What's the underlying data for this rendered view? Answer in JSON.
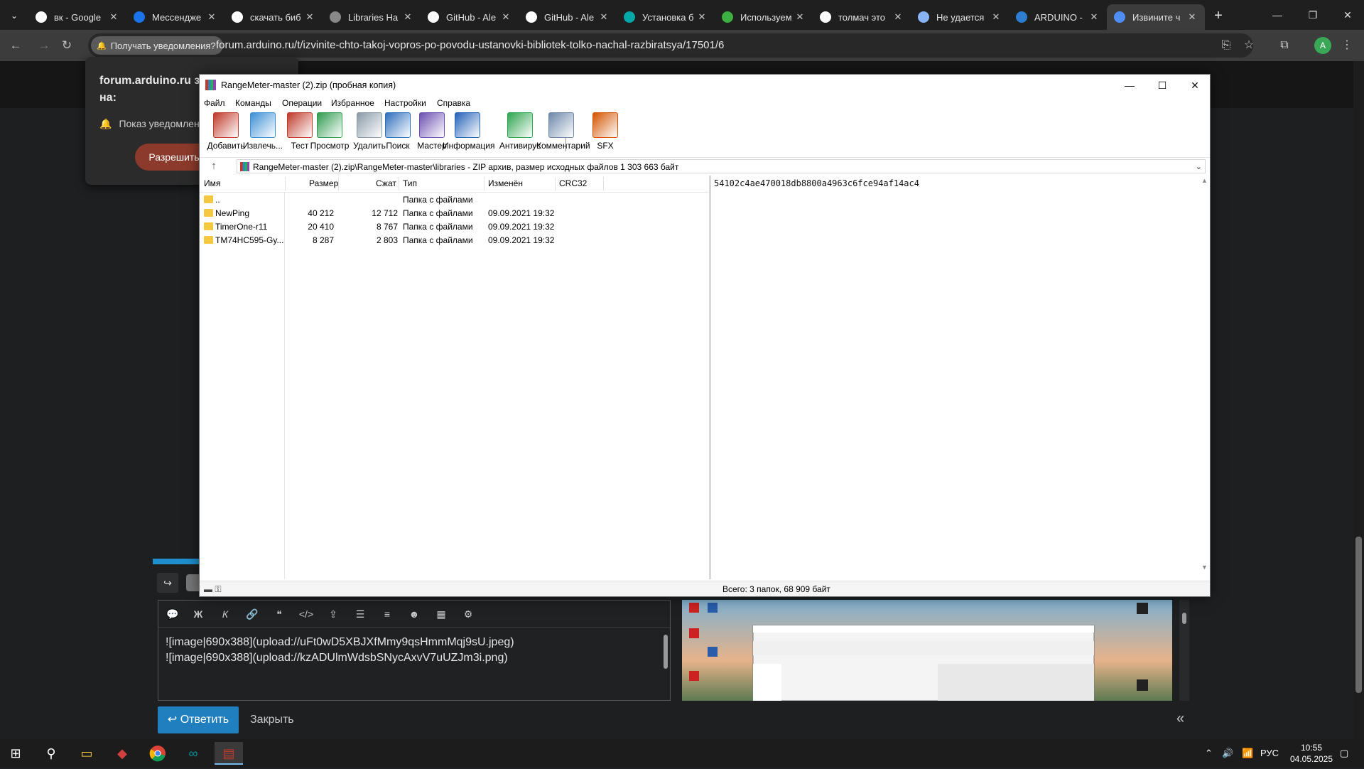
{
  "browser": {
    "tabs": [
      {
        "title": "вк - Google",
        "color": "#ffffff",
        "icon": "google-icon"
      },
      {
        "title": "Мессендже",
        "color": "#1a73e8",
        "icon": "messenger-icon"
      },
      {
        "title": "скачать биб",
        "color": "#ffffff",
        "icon": "google-icon"
      },
      {
        "title": "Libraries Ha",
        "color": "#888888",
        "icon": "globe-icon"
      },
      {
        "title": "GitHub - Ale",
        "color": "#ffffff",
        "icon": "github-icon"
      },
      {
        "title": "GitHub - Ale",
        "color": "#ffffff",
        "icon": "github-icon"
      },
      {
        "title": "Установка б",
        "color": "#00a8a8",
        "icon": "arduino-icon"
      },
      {
        "title": "Используем",
        "color": "#3cb043",
        "icon": "x-site-icon"
      },
      {
        "title": "толмач это",
        "color": "#ffffff",
        "icon": "google-icon"
      },
      {
        "title": "Не удается",
        "color": "#8ab4f8",
        "icon": "page-icon"
      },
      {
        "title": "ARDUINO -",
        "color": "#2e7dd1",
        "icon": "x-site-icon"
      },
      {
        "title": "Извините ч",
        "color": "#4f8ef7",
        "icon": "forum-icon"
      }
    ],
    "notif_chip": "Получать уведомления?",
    "url": "forum.arduino.ru/t/izvinite-chto-takoj-vopros-po-povodu-ustanovki-bibliotek-tolko-nachal-razbiratsya/17501/6",
    "avatar_letter": "A"
  },
  "permission_popup": {
    "title": "forum.arduino.ru з разрешение на:",
    "item": "Показ уведомлени",
    "allow": "Разрешить"
  },
  "winrar": {
    "title": "RangeMeter-master (2).zip (пробная копия)",
    "menu": [
      "Файл",
      "Команды",
      "Операции",
      "Избранное",
      "Настройки",
      "Справка"
    ],
    "tools": [
      {
        "label": "Добавить",
        "icon": "add-icon",
        "color": "#c0392b"
      },
      {
        "label": "Извлечь...",
        "icon": "extract-icon",
        "color": "#3a8fd6"
      },
      {
        "label": "Тест",
        "icon": "test-icon",
        "color": "#c0392b"
      },
      {
        "label": "Просмотр",
        "icon": "view-icon",
        "color": "#2e9b4f"
      },
      {
        "label": "Удалить",
        "icon": "delete-icon",
        "color": "#8a9aa8"
      },
      {
        "label": "Поиск",
        "icon": "find-icon",
        "color": "#2c6fbd"
      },
      {
        "label": "Мастер",
        "icon": "wizard-icon",
        "color": "#6b4fb0"
      },
      {
        "label": "Информация",
        "icon": "info-icon",
        "color": "#2563b8"
      },
      {
        "label": "Антивирус",
        "icon": "antivirus-icon",
        "color": "#2ea44f"
      },
      {
        "label": "Комментарий",
        "icon": "comment-icon",
        "color": "#6c87a8"
      },
      {
        "label": "SFX",
        "icon": "sfx-icon",
        "color": "#d35400"
      }
    ],
    "path": "RangeMeter-master (2).zip\\RangeMeter-master\\libraries - ZIP архив, размер исходных файлов 1 303 663 байт",
    "columns": [
      "Имя",
      "Размер",
      "Сжат",
      "Тип",
      "Изменён",
      "CRC32"
    ],
    "files": [
      {
        "name": "..",
        "size": "",
        "packed": "",
        "type": "Папка с файлами",
        "modified": "",
        "crc": ""
      },
      {
        "name": "NewPing",
        "size": "40 212",
        "packed": "12 712",
        "type": "Папка с файлами",
        "modified": "09.09.2021 19:32",
        "crc": ""
      },
      {
        "name": "TimerOne-r11",
        "size": "20 410",
        "packed": "8 767",
        "type": "Папка с файлами",
        "modified": "09.09.2021 19:32",
        "crc": ""
      },
      {
        "name": "TM74HC595-Gy...",
        "size": "8 287",
        "packed": "2 803",
        "type": "Папка с файлами",
        "modified": "09.09.2021 19:32",
        "crc": ""
      }
    ],
    "comment": "54102c4ae470018db8800a4963c6fce94af14ac4",
    "status": "Всего: 3 папок, 68 909 байт"
  },
  "composer": {
    "lines": [
      "![image|690x388](upload://uFt0wD5XBJXfMmy9qsHmmMqj9sU.jpeg)",
      "![image|690x388](upload://kzADUlmWdsbSNycAxvV7uUZJm3i.png)"
    ],
    "reply_label": "Ответить",
    "close_label": "Закрыть"
  },
  "taskbar": {
    "lang": "РУС",
    "time": "10:55",
    "date": "04.05.2025"
  }
}
